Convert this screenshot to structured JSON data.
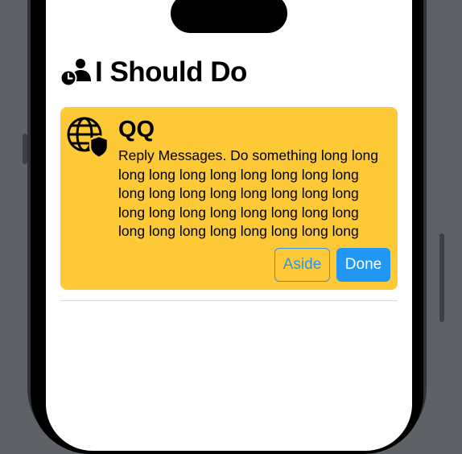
{
  "header": {
    "title": "I Should Do",
    "icon": "person-clock-icon"
  },
  "card": {
    "icon": "globe-shield-icon",
    "title": "QQ",
    "body": "Reply Messages. Do something long long long long long long long long long long long long long long long long long long long long long long long long long long long long long long long long long long",
    "background": "#fec936",
    "aside_label": "Aside",
    "done_label": "Done"
  },
  "colors": {
    "accent": "#2196f3"
  }
}
